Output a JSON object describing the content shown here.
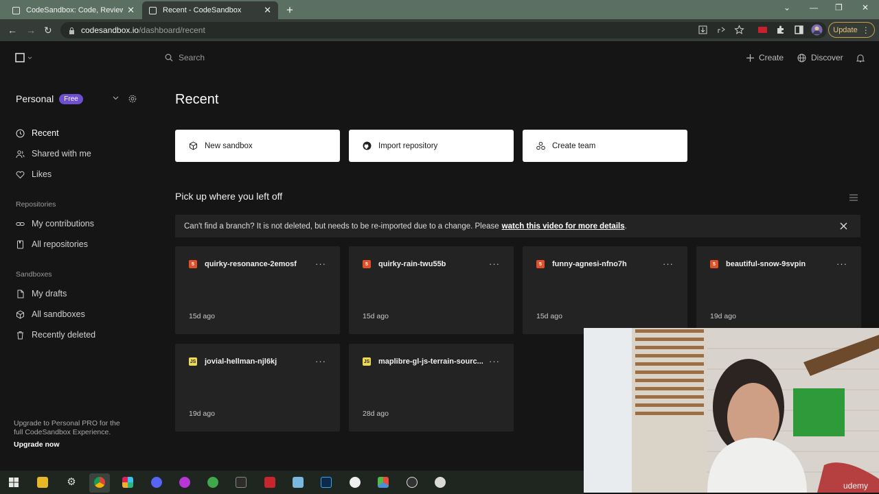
{
  "browser": {
    "tabs": [
      {
        "title": "CodeSandbox: Code, Review and",
        "close": "✕"
      },
      {
        "title": "Recent - CodeSandbox",
        "close": "✕"
      }
    ],
    "new_tab": "+",
    "window_controls": [
      "⌄",
      "—",
      "❐",
      "✕"
    ],
    "url_host": "codesandbox.io",
    "url_path": "/dashboard/recent",
    "update_label": "Update"
  },
  "topbar": {
    "search_placeholder": "Search",
    "create_label": "Create",
    "discover_label": "Discover"
  },
  "sidebar": {
    "workspace_name": "Personal",
    "workspace_badge": "Free",
    "items": [
      {
        "label": "Recent"
      },
      {
        "label": "Shared with me"
      },
      {
        "label": "Likes"
      }
    ],
    "repositories_heading": "Repositories",
    "repo_items": [
      {
        "label": "My contributions"
      },
      {
        "label": "All repositories"
      }
    ],
    "sandboxes_heading": "Sandboxes",
    "sandbox_items": [
      {
        "label": "My drafts"
      },
      {
        "label": "All sandboxes"
      },
      {
        "label": "Recently deleted"
      }
    ],
    "upgrade_text": "Upgrade to Personal PRO for the full CodeSandbox Experience.",
    "upgrade_link": "Upgrade now"
  },
  "main": {
    "title": "Recent",
    "actions": [
      {
        "label": "New sandbox"
      },
      {
        "label": "Import repository"
      },
      {
        "label": "Create team"
      }
    ],
    "section_title": "Pick up where you left off",
    "banner_text": "Can't find a branch? It is not deleted, but needs to be re-imported due to a change. Please",
    "banner_link": "watch this video for more details",
    "banner_end": ".",
    "sandboxes": [
      {
        "name": "quirky-resonance-2emosf",
        "age": "15d ago",
        "icon": "html5",
        "icon_text": "5"
      },
      {
        "name": "quirky-rain-twu55b",
        "age": "15d ago",
        "icon": "html5",
        "icon_text": "5"
      },
      {
        "name": "funny-agnesi-nfno7h",
        "age": "15d ago",
        "icon": "html5",
        "icon_text": "5"
      },
      {
        "name": "beautiful-snow-9svpin",
        "age": "19d ago",
        "icon": "html5",
        "icon_text": "5"
      },
      {
        "name": "jovial-hellman-njl6kj",
        "age": "19d ago",
        "icon": "js",
        "icon_text": "JS"
      },
      {
        "name": "maplibre-gl-js-terrain-sourc...",
        "age": "28d ago",
        "icon": "js",
        "icon_text": "JS"
      }
    ],
    "more_label": "···"
  },
  "colors": {
    "accent": "#6e4fd0",
    "html5": "#e34f26",
    "js": "#f0db4f"
  },
  "video_watermark": "udemy"
}
